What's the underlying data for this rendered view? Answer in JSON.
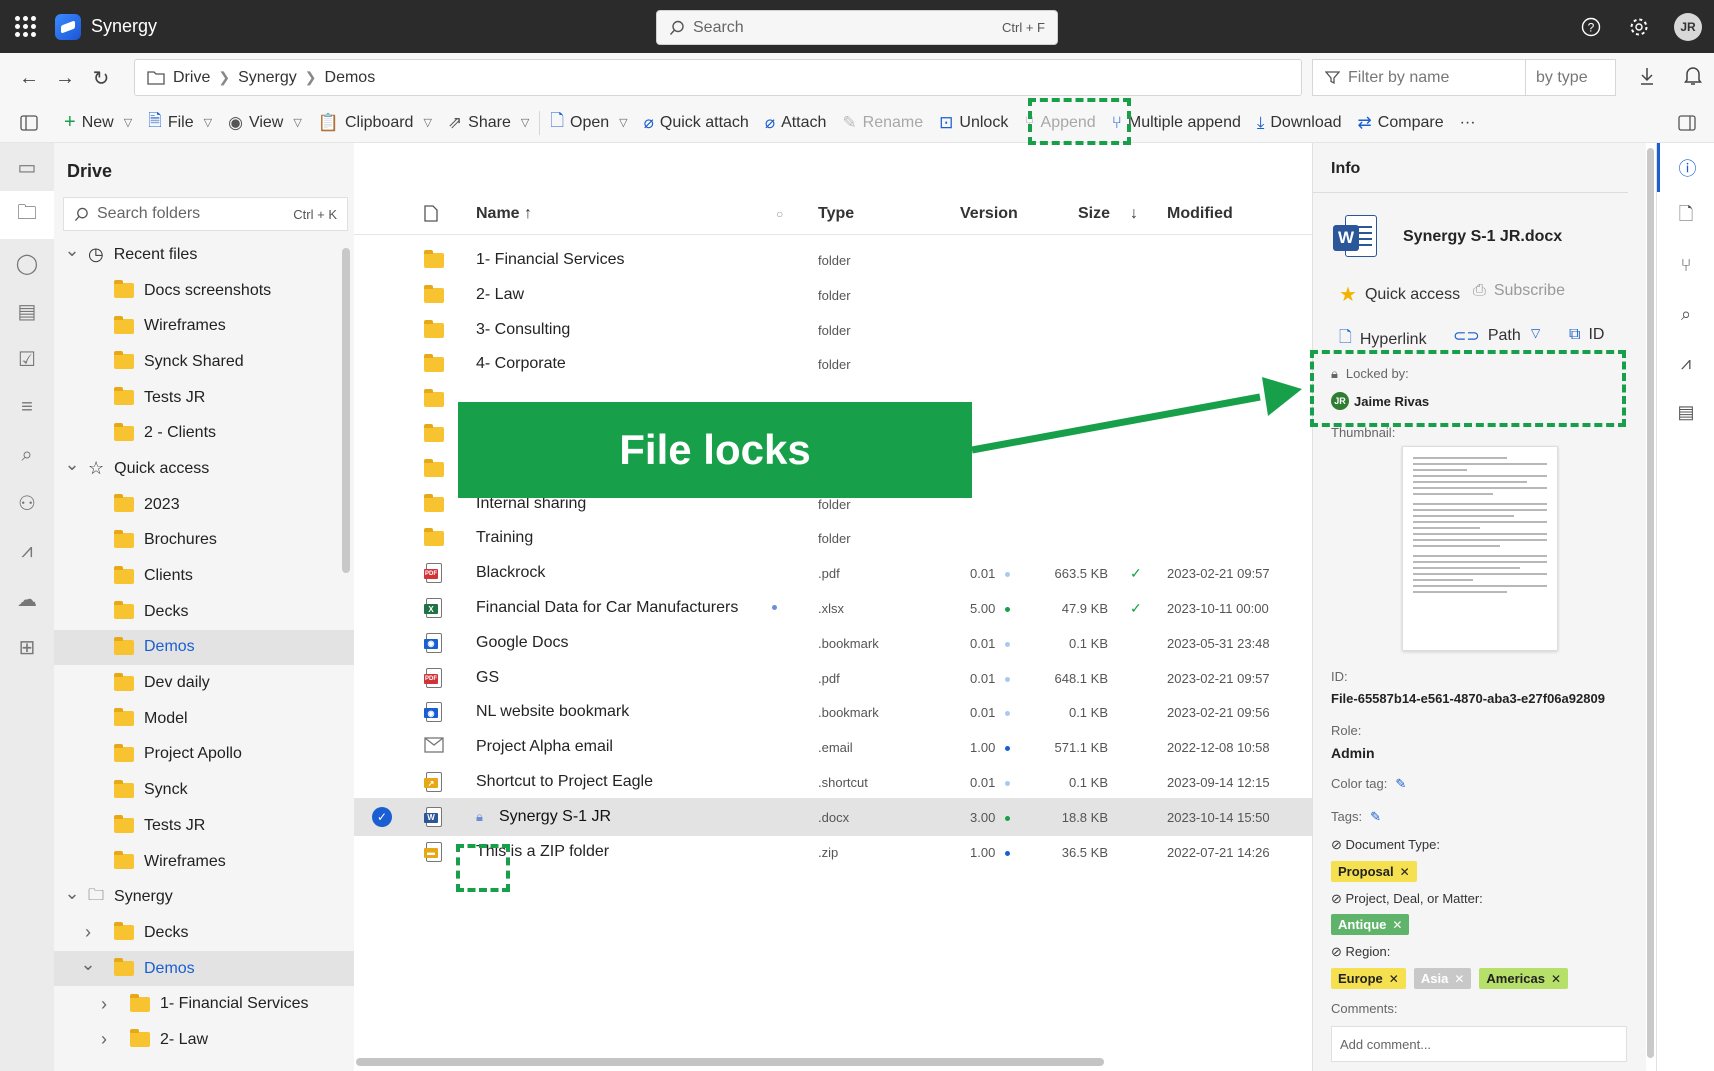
{
  "app": {
    "name": "Synergy",
    "user_initials": "JR"
  },
  "search": {
    "placeholder": "Search",
    "shortcut": "Ctrl + F"
  },
  "breadcrumb": [
    "Drive",
    "Synergy",
    "Demos"
  ],
  "filter": {
    "name_placeholder": "Filter by name",
    "type_placeholder": "by type"
  },
  "toolbar": {
    "new": "New",
    "file": "File",
    "view": "View",
    "clipboard": "Clipboard",
    "share": "Share",
    "open": "Open",
    "quick_attach": "Quick attach",
    "attach": "Attach",
    "rename": "Rename",
    "unlock": "Unlock",
    "append": "Append",
    "multiple_append": "Multiple append",
    "download": "Download",
    "compare": "Compare",
    "more": "···"
  },
  "tree": {
    "title": "Drive",
    "search_placeholder": "Search folders",
    "search_shortcut": "Ctrl + K",
    "nodes": [
      {
        "label": "Recent files",
        "level": 0,
        "type": "clock",
        "chevron": "down"
      },
      {
        "label": "Docs screenshots",
        "level": 1,
        "type": "folder"
      },
      {
        "label": "Wireframes",
        "level": 1,
        "type": "folder"
      },
      {
        "label": "Synck Shared",
        "level": 1,
        "type": "folder"
      },
      {
        "label": "Tests JR",
        "level": 1,
        "type": "folder"
      },
      {
        "label": "2 - Clients",
        "level": 1,
        "type": "folder"
      },
      {
        "label": "Quick access",
        "level": 0,
        "type": "star",
        "chevron": "down"
      },
      {
        "label": "2023",
        "level": 1,
        "type": "folder"
      },
      {
        "label": "Brochures",
        "level": 1,
        "type": "folder"
      },
      {
        "label": "Clients",
        "level": 1,
        "type": "folder"
      },
      {
        "label": "Decks",
        "level": 1,
        "type": "folder"
      },
      {
        "label": "Demos",
        "level": 1,
        "type": "folder",
        "selected": true
      },
      {
        "label": "Dev daily",
        "level": 1,
        "type": "folder"
      },
      {
        "label": "Model",
        "level": 1,
        "type": "folder"
      },
      {
        "label": "Project Apollo",
        "level": 1,
        "type": "folder"
      },
      {
        "label": "Synck",
        "level": 1,
        "type": "folder"
      },
      {
        "label": "Tests JR",
        "level": 1,
        "type": "folder"
      },
      {
        "label": "Wireframes",
        "level": 1,
        "type": "folder"
      },
      {
        "label": "Synergy",
        "level": 0,
        "type": "outline-folder",
        "chevron": "down"
      },
      {
        "label": "Decks",
        "level": 1,
        "type": "folder",
        "chevron": "right"
      },
      {
        "label": "Demos",
        "level": 1,
        "type": "folder",
        "chevron": "down",
        "selected": true
      },
      {
        "label": "1- Financial Services",
        "level": 2,
        "type": "folder",
        "chevron": "right"
      },
      {
        "label": "2- Law",
        "level": 2,
        "type": "folder",
        "chevron": "right"
      }
    ]
  },
  "columns": {
    "name": "Name ↑",
    "type": "Type",
    "version": "Version",
    "size": "Size",
    "modified": "Modified"
  },
  "files": [
    {
      "name": "1- Financial Services",
      "type": "folder",
      "icon": "folder"
    },
    {
      "name": "2- Law",
      "type": "folder",
      "icon": "folder"
    },
    {
      "name": "3- Consulting",
      "type": "folder",
      "icon": "folder"
    },
    {
      "name": "4- Corporate",
      "type": "folder",
      "icon": "folder"
    },
    {
      "name": "",
      "type": "",
      "icon": "folder"
    },
    {
      "name": "",
      "type": "",
      "icon": "folder"
    },
    {
      "name": "",
      "type": "",
      "icon": "folder"
    },
    {
      "name": "Internal sharing",
      "type": "folder",
      "icon": "folder"
    },
    {
      "name": "Training",
      "type": "folder",
      "icon": "folder"
    },
    {
      "name": "Blackrock",
      "type": ".pdf",
      "icon": "pdf",
      "version": "0.01",
      "vdot": "#a9c9f0",
      "size": "663.5 KB",
      "check": true,
      "modified": "2023-02-21 09:57"
    },
    {
      "name": "Financial Data for Car Manufacturers",
      "type": ".xlsx",
      "icon": "xlsx",
      "version": "5.00",
      "vdot": "#17a049",
      "size": "47.9 KB",
      "check": true,
      "modified": "2023-10-11 00:00",
      "flag": true
    },
    {
      "name": "Google Docs",
      "type": ".bookmark",
      "icon": "bookmark",
      "version": "0.01",
      "vdot": "#a9c9f0",
      "size": "0.1 KB",
      "modified": "2023-05-31 23:48"
    },
    {
      "name": "GS",
      "type": ".pdf",
      "icon": "pdf",
      "version": "0.01",
      "vdot": "#a9c9f0",
      "size": "648.1 KB",
      "modified": "2023-02-21 09:57"
    },
    {
      "name": "NL website bookmark",
      "type": ".bookmark",
      "icon": "bookmark",
      "version": "0.01",
      "vdot": "#a9c9f0",
      "size": "0.1 KB",
      "modified": "2023-02-21 09:56"
    },
    {
      "name": "Project Alpha email",
      "type": ".email",
      "icon": "email",
      "version": "1.00",
      "vdot": "#1a5fd1",
      "size": "571.1 KB",
      "modified": "2022-12-08 10:58"
    },
    {
      "name": "Shortcut to Project Eagle",
      "type": ".shortcut",
      "icon": "shortcut",
      "version": "0.01",
      "vdot": "#a9c9f0",
      "size": "0.1 KB",
      "modified": "2023-09-14 12:15"
    },
    {
      "name": "Synergy S-1 JR",
      "type": ".docx",
      "icon": "docx",
      "version": "3.00",
      "vdot": "#17a049",
      "size": "18.8 KB",
      "modified": "2023-10-14 15:50",
      "selected": true,
      "locked": true
    },
    {
      "name": "This is a ZIP folder",
      "type": ".zip",
      "icon": "zip",
      "version": "1.00",
      "vdot": "#1a5fd1",
      "size": "36.5 KB",
      "modified": "2022-07-21 14:26"
    }
  ],
  "overlay": {
    "banner": "File locks"
  },
  "info": {
    "title": "Info",
    "file_name": "Synergy S-1 JR.docx",
    "quick_access": "Quick access",
    "subscribe": "Subscribe",
    "hyperlink": "Hyperlink",
    "path": "Path",
    "id_btn": "ID",
    "locked_by_label": "Locked by:",
    "locked_by_initials": "JR",
    "locked_by_name": "Jaime Rivas",
    "thumbnail_label": "Thumbnail:",
    "id_label": "ID:",
    "id_value": "File-65587b14-e561-4870-aba3-e27f06a92809",
    "role_label": "Role:",
    "role_value": "Admin",
    "color_tag_label": "Color tag:",
    "tags_label": "Tags:",
    "doc_type_label": "Document Type:",
    "doc_type_tags": [
      {
        "label": "Proposal",
        "bg": "#f5e050",
        "fg": "#222"
      }
    ],
    "project_label": "Project, Deal, or Matter:",
    "project_tags": [
      {
        "label": "Antique",
        "bg": "#5fb36a",
        "fg": "#fff"
      }
    ],
    "region_label": "Region:",
    "region_tags": [
      {
        "label": "Europe",
        "bg": "#f5e050",
        "fg": "#222"
      },
      {
        "label": "Asia",
        "bg": "#c8c8c8",
        "fg": "#fff"
      },
      {
        "label": "Americas",
        "bg": "#b7e06a",
        "fg": "#222"
      }
    ],
    "comments_label": "Comments:",
    "comment_placeholder": "Add comment..."
  }
}
